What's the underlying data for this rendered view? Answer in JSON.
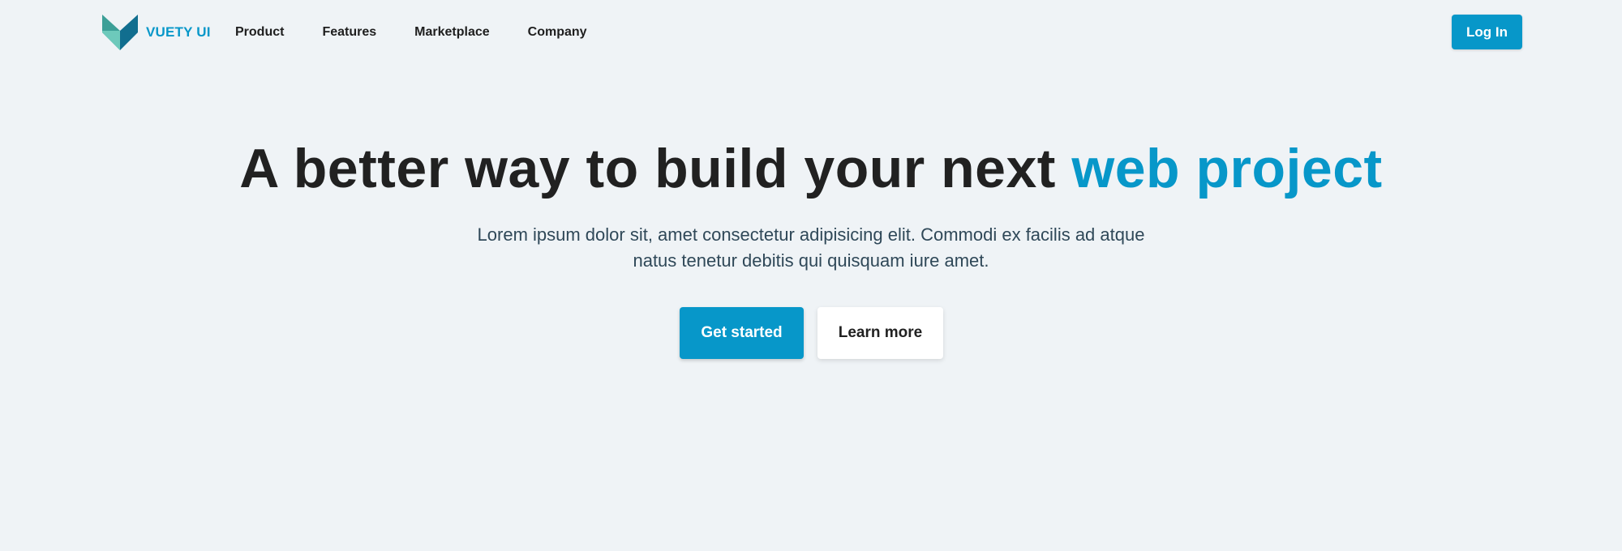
{
  "colors": {
    "accent": "#0797c9",
    "background": "#eff3f6",
    "heading": "#212121",
    "subtext": "#2f4858",
    "logo_light": "#6dc9bb",
    "logo_mid": "#3c9f97",
    "logo_dark": "#116e8f"
  },
  "brand": {
    "name": "VUETY UI",
    "logo_icon": "vuety-logo-icon"
  },
  "nav": {
    "items": [
      {
        "label": "Product"
      },
      {
        "label": "Features"
      },
      {
        "label": "Marketplace"
      },
      {
        "label": "Company"
      }
    ]
  },
  "header": {
    "login_label": "Log In"
  },
  "hero": {
    "title_main": "A better way to build your next ",
    "title_highlight": "web project",
    "subtitle": "Lorem ipsum dolor sit, amet consectetur adipisicing elit. Commodi ex facilis ad atque natus tenetur debitis qui quisquam iure amet.",
    "primary_cta": "Get started",
    "secondary_cta": "Learn more"
  }
}
